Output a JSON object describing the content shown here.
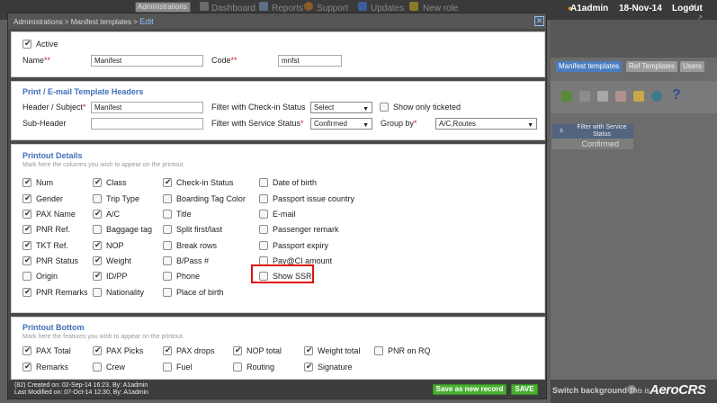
{
  "background": {
    "admin_select": "Administrations",
    "nav": [
      "Dashboard",
      "Reports",
      "Support",
      "Updates",
      "New role"
    ],
    "user": "A1admin",
    "date": "18-Nov-14",
    "logout": "Logout",
    "tabs": [
      "Manifest templates",
      "Ref Templates",
      "Users"
    ],
    "table": {
      "header": "Filter with Service Status",
      "header_left": "s",
      "value": "Confirmed"
    },
    "switch_background": "Switch background",
    "this_is": "This is",
    "brand": "AeroCRS"
  },
  "modal": {
    "breadcrumb": "Administrations > Manifest templates > ",
    "breadcrumb_current": "Edit",
    "general": {
      "active_label": "Active",
      "active_checked": true,
      "name_label": "Name",
      "name_value": "Manifest",
      "code_label": "Code",
      "code_value": "mnfst"
    },
    "headers": {
      "title": "Print / E-mail Template Headers",
      "header_label": "Header / Subject",
      "header_value": "Manifest",
      "subheader_label": "Sub-Header",
      "subheader_value": "",
      "checkin_filter_label": "Filter with Check-in Status",
      "checkin_filter_value": "Select",
      "show_ticketed_label": "Show only ticketed",
      "show_ticketed_checked": false,
      "service_filter_label": "Filter with Service Status",
      "service_filter_value": "Confirmed",
      "groupby_label": "Group by",
      "groupby_value": "A/C,Routes"
    },
    "details": {
      "title": "Printout Details",
      "hint": "Mark here the columns you wish to appear on the printout.",
      "columns": [
        [
          {
            "label": "Num",
            "checked": true
          },
          {
            "label": "Gender",
            "checked": true
          },
          {
            "label": "PAX Name",
            "checked": true
          },
          {
            "label": "PNR Ref.",
            "checked": true
          },
          {
            "label": "TKT Ref.",
            "checked": true
          },
          {
            "label": "PNR Status",
            "checked": true
          },
          {
            "label": "Origin",
            "checked": false
          },
          {
            "label": "PNR Remarks",
            "checked": true
          }
        ],
        [
          {
            "label": "Class",
            "checked": true
          },
          {
            "label": "Trip Type",
            "checked": false
          },
          {
            "label": "A/C",
            "checked": true
          },
          {
            "label": "Baggage tag",
            "checked": false
          },
          {
            "label": "NOP",
            "checked": true
          },
          {
            "label": "Weight",
            "checked": true
          },
          {
            "label": "ID/PP",
            "checked": true
          },
          {
            "label": "Nationality",
            "checked": false
          }
        ],
        [
          {
            "label": "Check-in Status",
            "checked": true
          },
          {
            "label": "Boarding Tag Color",
            "checked": false
          },
          {
            "label": "Title",
            "checked": false
          },
          {
            "label": "Split first/last",
            "checked": false
          },
          {
            "label": "Break rows",
            "checked": false
          },
          {
            "label": "B/Pass #",
            "checked": false
          },
          {
            "label": "Phone",
            "checked": false
          },
          {
            "label": "Place of birth",
            "checked": false
          }
        ],
        [
          {
            "label": "Date of birth",
            "checked": false
          },
          {
            "label": "Passport issue country",
            "checked": false
          },
          {
            "label": "E-mail",
            "checked": false
          },
          {
            "label": "Passenger remark",
            "checked": false
          },
          {
            "label": "Passport expiry",
            "checked": false
          },
          {
            "label": "Pay@CI amount",
            "checked": false
          },
          {
            "label": "Show SSR",
            "checked": false
          }
        ]
      ]
    },
    "bottom": {
      "title": "Printout Bottom",
      "hint": "Mark here the features you wish to appear on the printout.",
      "rows": [
        [
          {
            "label": "PAX Total",
            "checked": true
          },
          {
            "label": "PAX Picks",
            "checked": true
          },
          {
            "label": "PAX drops",
            "checked": true
          },
          {
            "label": "NOP total",
            "checked": true
          },
          {
            "label": "Weight total",
            "checked": true
          },
          {
            "label": "PNR on RQ",
            "checked": false
          }
        ],
        [
          {
            "label": "Remarks",
            "checked": true
          },
          {
            "label": "Crew",
            "checked": false
          },
          {
            "label": "Fuel",
            "checked": false
          },
          {
            "label": "Routing",
            "checked": false
          },
          {
            "label": "Signature",
            "checked": true
          }
        ]
      ]
    },
    "footer": {
      "created": "(82) Created on: 02-Sep-14 16:23, By: A1admin",
      "modified": "Last Modified on: 07-Oct-14 12:30, By: A1admin",
      "save_new_label": "Save as new record",
      "save_label": "SAVE"
    }
  }
}
